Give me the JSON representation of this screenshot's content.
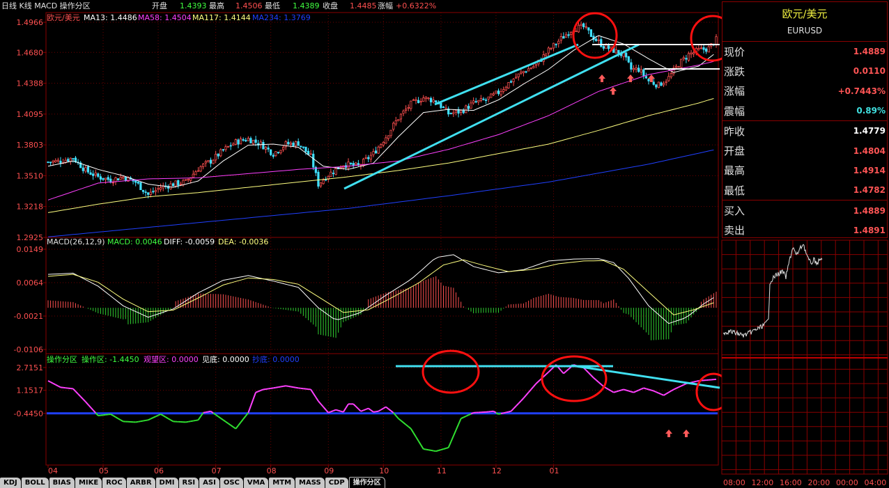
{
  "header": {
    "chart_label": "日线 K线 MACD 操作分区",
    "open_label": "开盘",
    "open": "1.4393",
    "high_label": "最高",
    "high": "1.4506",
    "low_label": "最低",
    "low": "1.4389",
    "close_label": "收盘",
    "close": "1.4485",
    "chg_label": "涨幅",
    "chg": "+0.6322%"
  },
  "main_legend": {
    "symbol": "欧元/美元",
    "ma13": "MA13: 1.4486",
    "ma58": "MA58: 1.4504",
    "ma117": "MA117: 1.4144",
    "ma234": "MA234: 1.3769"
  },
  "macd_legend": {
    "name": "MACD(26,12,9)",
    "macd": "MACD: 0.0046",
    "diff": "DIFF: -0.0059",
    "dea": "DEA: -0.0036"
  },
  "zone_legend": {
    "name": "操作分区",
    "op": "操作区: -1.4450",
    "watch": "观望区: 0.0000",
    "bottom": "见底: 0.0000",
    "buy": "抄底: 0.0000"
  },
  "quote": {
    "name": "欧元/美元",
    "code": "EURUSD",
    "rows": [
      {
        "label": "现价",
        "value": "1.4889",
        "color": "#ff5555"
      },
      {
        "label": "涨跌",
        "value": "0.0110",
        "color": "#ff5555"
      },
      {
        "label": "涨幅",
        "value": "+0.7443%",
        "color": "#ff5555"
      },
      {
        "label": "震幅",
        "value": "0.89%",
        "color": "#40e0e0"
      },
      {
        "label": "昨收",
        "value": "1.4779",
        "color": "#ffffff"
      },
      {
        "label": "开盘",
        "value": "1.4804",
        "color": "#ff5555"
      },
      {
        "label": "最高",
        "value": "1.4914",
        "color": "#ff5555"
      },
      {
        "label": "最低",
        "value": "1.4782",
        "color": "#ff5555"
      },
      {
        "label": "买入",
        "value": "1.4889",
        "color": "#ff5555"
      },
      {
        "label": "卖出",
        "value": "1.4891",
        "color": "#ff5555"
      }
    ]
  },
  "tabs": [
    "KDJ",
    "BOLL",
    "BIAS",
    "MIKE",
    "ROC",
    "ARBR",
    "DMI",
    "RSI",
    "ASI",
    "OSC",
    "VMA",
    "MTM",
    "MASS",
    "CDP",
    "操作分区"
  ],
  "active_tab": "操作分区",
  "colors": {
    "up": "#ff5050",
    "down": "#40e0ff",
    "ma13": "#ffffff",
    "ma58": "#ff40ff",
    "ma117": "#ffff80",
    "ma234": "#2040ff",
    "grid": "#8a0000",
    "annotation": "#ff1010",
    "trend": "#40e0f0"
  },
  "chart_data": [
    {
      "type": "candlestick",
      "name": "欧元/美元 daily",
      "x": [
        "04",
        "05",
        "06",
        "07",
        "08",
        "09",
        "10",
        "11",
        "12",
        "01"
      ],
      "y_ticks": [
        "1.4966",
        "1.4680",
        "1.4388",
        "1.4095",
        "1.3803",
        "1.3510",
        "1.3218",
        "1.2925"
      ],
      "ylim": [
        1.2925,
        1.4966
      ],
      "anchors": [
        [
          0,
          1.364
        ],
        [
          5,
          1.365
        ],
        [
          10,
          1.368
        ],
        [
          15,
          1.356
        ],
        [
          20,
          1.35
        ],
        [
          25,
          1.347
        ],
        [
          30,
          1.35
        ],
        [
          35,
          1.345
        ],
        [
          40,
          1.333
        ],
        [
          45,
          1.34
        ],
        [
          50,
          1.343
        ],
        [
          55,
          1.345
        ],
        [
          60,
          1.358
        ],
        [
          65,
          1.365
        ],
        [
          70,
          1.375
        ],
        [
          75,
          1.383
        ],
        [
          80,
          1.386
        ],
        [
          85,
          1.381
        ],
        [
          90,
          1.372
        ],
        [
          95,
          1.381
        ],
        [
          100,
          1.382
        ],
        [
          105,
          1.369
        ],
        [
          108,
          1.343
        ],
        [
          112,
          1.352
        ],
        [
          118,
          1.362
        ],
        [
          124,
          1.36
        ],
        [
          130,
          1.372
        ],
        [
          135,
          1.388
        ],
        [
          140,
          1.406
        ],
        [
          145,
          1.419
        ],
        [
          150,
          1.425
        ],
        [
          155,
          1.422
        ],
        [
          160,
          1.41
        ],
        [
          165,
          1.412
        ],
        [
          170,
          1.42
        ],
        [
          175,
          1.423
        ],
        [
          180,
          1.43
        ],
        [
          185,
          1.441
        ],
        [
          190,
          1.45
        ],
        [
          195,
          1.456
        ],
        [
          200,
          1.47
        ],
        [
          205,
          1.481
        ],
        [
          210,
          1.491
        ],
        [
          214,
          1.492
        ],
        [
          218,
          1.482
        ],
        [
          222,
          1.474
        ],
        [
          226,
          1.47
        ],
        [
          230,
          1.465
        ],
        [
          233,
          1.452
        ],
        [
          236,
          1.452
        ],
        [
          240,
          1.441
        ],
        [
          244,
          1.437
        ],
        [
          248,
          1.444
        ],
        [
          252,
          1.457
        ],
        [
          256,
          1.466
        ],
        [
          260,
          1.47
        ],
        [
          264,
          1.472
        ],
        [
          267,
          1.48
        ]
      ],
      "moving_averages": [
        {
          "name": "MA13",
          "values": [
            [
              0,
              1.36
            ],
            [
              10,
              1.365
            ],
            [
              20,
              1.357
            ],
            [
              30,
              1.351
            ],
            [
              40,
              1.343
            ],
            [
              50,
              1.34
            ],
            [
              60,
              1.346
            ],
            [
              70,
              1.365
            ],
            [
              80,
              1.38
            ],
            [
              90,
              1.381
            ],
            [
              100,
              1.378
            ],
            [
              110,
              1.36
            ],
            [
              120,
              1.357
            ],
            [
              130,
              1.363
            ],
            [
              140,
              1.388
            ],
            [
              150,
              1.411
            ],
            [
              160,
              1.414
            ],
            [
              170,
              1.413
            ],
            [
              180,
              1.423
            ],
            [
              190,
              1.438
            ],
            [
              200,
              1.452
            ],
            [
              210,
              1.47
            ],
            [
              220,
              1.484
            ],
            [
              230,
              1.476
            ],
            [
              240,
              1.462
            ],
            [
              250,
              1.449
            ],
            [
              260,
              1.455
            ],
            [
              267,
              1.468
            ]
          ]
        },
        {
          "name": "MA58",
          "values": [
            [
              0,
              1.328
            ],
            [
              20,
              1.344
            ],
            [
              40,
              1.348
            ],
            [
              60,
              1.349
            ],
            [
              80,
              1.353
            ],
            [
              100,
              1.357
            ],
            [
              120,
              1.36
            ],
            [
              140,
              1.365
            ],
            [
              160,
              1.376
            ],
            [
              180,
              1.39
            ],
            [
              200,
              1.408
            ],
            [
              220,
              1.431
            ],
            [
              240,
              1.447
            ],
            [
              260,
              1.456
            ],
            [
              267,
              1.46
            ]
          ]
        },
        {
          "name": "MA117",
          "values": [
            [
              0,
              1.316
            ],
            [
              20,
              1.324
            ],
            [
              40,
              1.331
            ],
            [
              60,
              1.335
            ],
            [
              80,
              1.34
            ],
            [
              100,
              1.345
            ],
            [
              120,
              1.35
            ],
            [
              140,
              1.356
            ],
            [
              160,
              1.363
            ],
            [
              180,
              1.372
            ],
            [
              200,
              1.381
            ],
            [
              220,
              1.394
            ],
            [
              240,
              1.408
            ],
            [
              260,
              1.42
            ],
            [
              267,
              1.425
            ]
          ]
        },
        {
          "name": "MA234",
          "values": [
            [
              0,
              1.293
            ],
            [
              40,
              1.302
            ],
            [
              80,
              1.311
            ],
            [
              120,
              1.32
            ],
            [
              160,
              1.332
            ],
            [
              200,
              1.345
            ],
            [
              240,
              1.362
            ],
            [
              267,
              1.376
            ]
          ]
        }
      ]
    },
    {
      "type": "macd",
      "name": "MACD(26,12,9)",
      "y_ticks": [
        "0.0149",
        "0.0064",
        "-0.0021",
        "-0.0106"
      ],
      "ylim": [
        -0.0106,
        0.0149
      ],
      "diff": [
        [
          0,
          0.0085
        ],
        [
          10,
          0.0088
        ],
        [
          20,
          0.0055
        ],
        [
          30,
          0.0005
        ],
        [
          40,
          -0.0024
        ],
        [
          50,
          -0.0003
        ],
        [
          60,
          0.0038
        ],
        [
          70,
          0.007
        ],
        [
          80,
          0.0082
        ],
        [
          90,
          0.0068
        ],
        [
          100,
          0.0052
        ],
        [
          108,
          0.0
        ],
        [
          115,
          -0.0032
        ],
        [
          125,
          -0.0012
        ],
        [
          135,
          0.0032
        ],
        [
          145,
          0.0072
        ],
        [
          155,
          0.0128
        ],
        [
          162,
          0.0135
        ],
        [
          170,
          0.0105
        ],
        [
          180,
          0.0089
        ],
        [
          190,
          0.0097
        ],
        [
          200,
          0.0119
        ],
        [
          210,
          0.0124
        ],
        [
          220,
          0.0125
        ],
        [
          226,
          0.0115
        ],
        [
          232,
          0.0075
        ],
        [
          240,
          0.0005
        ],
        [
          248,
          -0.004
        ],
        [
          255,
          -0.0025
        ],
        [
          262,
          0.001
        ],
        [
          267,
          0.003
        ]
      ],
      "dea": [
        [
          0,
          0.008
        ],
        [
          10,
          0.0085
        ],
        [
          20,
          0.0065
        ],
        [
          30,
          0.0022
        ],
        [
          40,
          -0.001
        ],
        [
          50,
          -0.0006
        ],
        [
          60,
          0.0025
        ],
        [
          70,
          0.0058
        ],
        [
          80,
          0.0076
        ],
        [
          90,
          0.0072
        ],
        [
          100,
          0.006
        ],
        [
          110,
          0.002
        ],
        [
          118,
          -0.0012
        ],
        [
          128,
          -0.0005
        ],
        [
          138,
          0.0028
        ],
        [
          148,
          0.0063
        ],
        [
          158,
          0.0109
        ],
        [
          166,
          0.0122
        ],
        [
          174,
          0.0108
        ],
        [
          184,
          0.0092
        ],
        [
          194,
          0.0098
        ],
        [
          204,
          0.0112
        ],
        [
          214,
          0.0119
        ],
        [
          222,
          0.012
        ],
        [
          230,
          0.0098
        ],
        [
          240,
          0.004
        ],
        [
          250,
          -0.0018
        ],
        [
          258,
          -0.0005
        ],
        [
          267,
          0.0015
        ]
      ]
    },
    {
      "type": "line",
      "name": "操作分区",
      "y_ticks": [
        "2.7151",
        "1.1517",
        "-0.4450"
      ],
      "ylim": [
        -4.0,
        2.9
      ],
      "threshold": -0.445,
      "values": [
        [
          0,
          1.8
        ],
        [
          5,
          1.35
        ],
        [
          10,
          1.25
        ],
        [
          15,
          0.35
        ],
        [
          20,
          -0.6
        ],
        [
          25,
          -0.5
        ],
        [
          30,
          -1.0
        ],
        [
          35,
          -1.05
        ],
        [
          40,
          -0.9
        ],
        [
          45,
          -0.5
        ],
        [
          50,
          -1.0
        ],
        [
          55,
          -1.05
        ],
        [
          60,
          -0.9
        ],
        [
          62,
          -0.4
        ],
        [
          65,
          -0.3
        ],
        [
          70,
          -0.9
        ],
        [
          75,
          -1.5
        ],
        [
          80,
          -0.4
        ],
        [
          83,
          1.0
        ],
        [
          86,
          1.2
        ],
        [
          90,
          1.3
        ],
        [
          95,
          1.45
        ],
        [
          100,
          1.3
        ],
        [
          105,
          1.2
        ],
        [
          108,
          0.4
        ],
        [
          112,
          -0.4
        ],
        [
          115,
          -0.2
        ],
        [
          118,
          -0.35
        ],
        [
          120,
          0.2
        ],
        [
          122,
          0.2
        ],
        [
          125,
          -0.3
        ],
        [
          128,
          -0.1
        ],
        [
          130,
          -0.35
        ],
        [
          132,
          -0.3
        ],
        [
          135,
          0.0
        ],
        [
          138,
          -0.4
        ],
        [
          140,
          -0.8
        ],
        [
          145,
          -1.5
        ],
        [
          150,
          -2.9
        ],
        [
          155,
          -3.05
        ],
        [
          160,
          -2.8
        ],
        [
          165,
          -0.8
        ],
        [
          170,
          -0.4
        ],
        [
          175,
          -0.35
        ],
        [
          178,
          -0.3
        ],
        [
          180,
          -0.5
        ],
        [
          185,
          -0.3
        ],
        [
          190,
          0.6
        ],
        [
          195,
          1.6
        ],
        [
          200,
          2.4
        ],
        [
          203,
          2.9
        ],
        [
          206,
          2.3
        ],
        [
          210,
          2.9
        ],
        [
          214,
          2.7
        ],
        [
          218,
          2.0
        ],
        [
          222,
          1.4
        ],
        [
          226,
          1.0
        ],
        [
          230,
          1.2
        ],
        [
          234,
          1.0
        ],
        [
          238,
          1.3
        ],
        [
          242,
          1.1
        ],
        [
          246,
          0.8
        ],
        [
          250,
          1.2
        ],
        [
          255,
          1.6
        ],
        [
          260,
          1.8
        ],
        [
          267,
          1.9
        ]
      ]
    }
  ]
}
